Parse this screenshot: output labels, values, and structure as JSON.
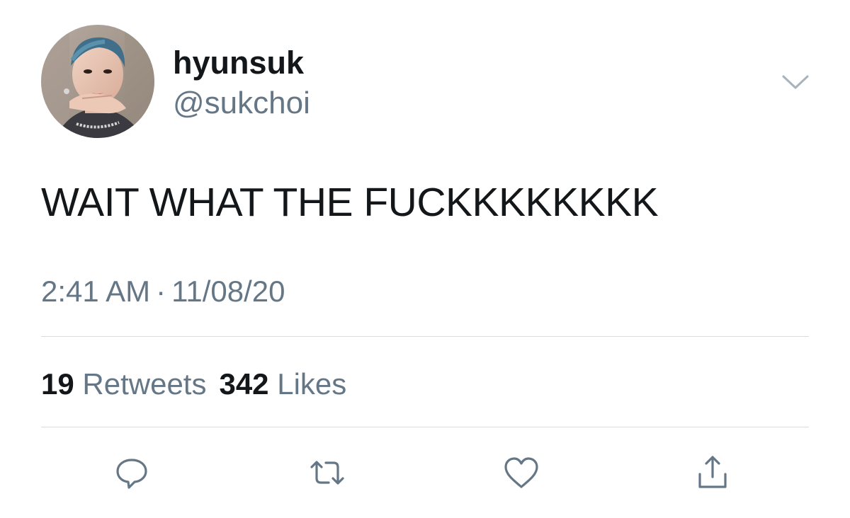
{
  "tweet": {
    "author": {
      "display_name": "hyunsuk",
      "handle": "@sukchoi",
      "avatar": "profile-photo"
    },
    "text": "WAIT WHAT THE FUCKKKKKKKK",
    "time": "2:41 AM",
    "separator": "·",
    "date": "11/08/20",
    "stats": {
      "retweets_count": "19",
      "retweets_label": "Retweets",
      "likes_count": "342",
      "likes_label": "Likes"
    },
    "actions": [
      {
        "name": "reply",
        "icon": "comment-icon"
      },
      {
        "name": "retweet",
        "icon": "retweet-icon"
      },
      {
        "name": "like",
        "icon": "heart-icon"
      },
      {
        "name": "share",
        "icon": "share-icon"
      }
    ],
    "menu_icon": "chevron-down-icon"
  },
  "colors": {
    "primary_text": "#14171a",
    "secondary_text": "#657786",
    "divider": "#d8dde1",
    "icon": "#657786"
  }
}
